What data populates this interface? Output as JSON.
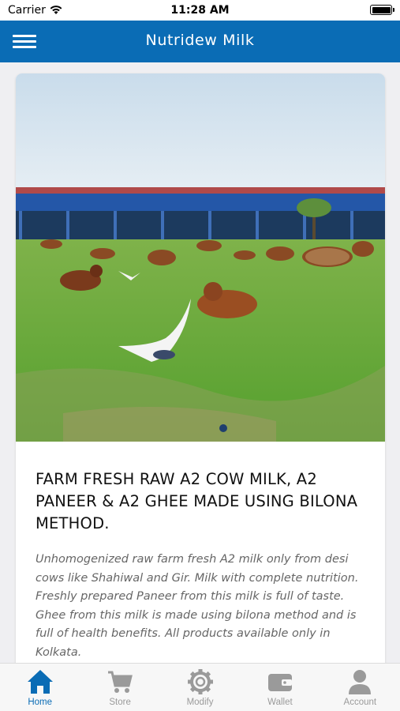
{
  "status_bar": {
    "carrier": "Carrier",
    "time": "11:28 AM",
    "icons": [
      "wifi-icon",
      "battery-icon"
    ]
  },
  "header": {
    "title": "Nutridew Milk",
    "menu_icon": "hamburger-menu-icon"
  },
  "banner": {
    "image": "farm-cows-grazing-photo",
    "carousel_dots": 1,
    "active_dot": 0
  },
  "product": {
    "title": "FARM FRESH RAW A2 COW MILK, A2 PANEER & A2 GHEE MADE USING BILONA METHOD.",
    "description": "Unhomogenized raw farm fresh A2 milk only from desi cows like Shahiwal and Gir. Milk with complete nutrition. Freshly prepared Paneer from this milk is full of taste. Ghee from this milk is made using bilona method and is full of health benefits. All products available only in Kolkata."
  },
  "tabs": [
    {
      "label": "Home",
      "icon": "home-icon",
      "active": true
    },
    {
      "label": "Store",
      "icon": "cart-icon",
      "active": false
    },
    {
      "label": "Modify",
      "icon": "gear-icon",
      "active": false
    },
    {
      "label": "Wallet",
      "icon": "wallet-icon",
      "active": false
    },
    {
      "label": "Account",
      "icon": "person-icon",
      "active": false
    }
  ],
  "colors": {
    "header_bg": "#0a6cb5",
    "tab_active": "#0a6cb5",
    "tab_inactive": "#9a9a9a",
    "page_bg": "#efeff2"
  }
}
